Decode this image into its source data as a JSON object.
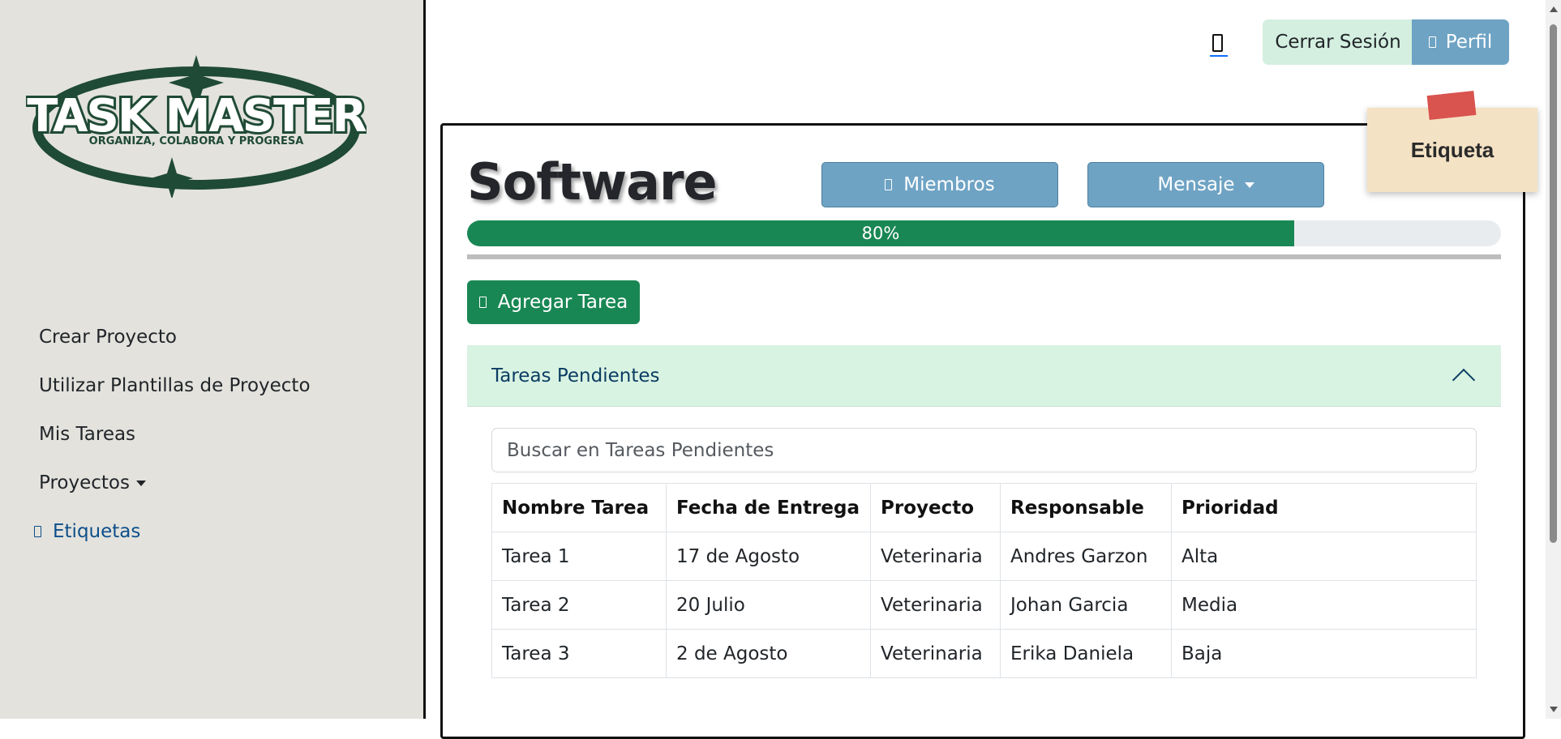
{
  "logo": {
    "title": "TASK MASTER",
    "tagline": "ORGANIZA, COLABORA Y PROGRESA"
  },
  "sidebar": {
    "items": [
      {
        "label": "Crear Proyecto"
      },
      {
        "label": "Utilizar Plantillas de Proyecto"
      },
      {
        "label": "Mis Tareas"
      },
      {
        "label": "Proyectos"
      },
      {
        "label": "Etiquetas",
        "icon": "label-icon",
        "active": true
      }
    ]
  },
  "header": {
    "phone_icon": "phone-icon",
    "logout_label": "Cerrar Sesión",
    "profile_label": "Perfil"
  },
  "project": {
    "title": "Software",
    "members_label": "Miembros",
    "message_label": "Mensaje",
    "progress_percent": 80,
    "progress_label": "80%",
    "add_task_label": "Agregar Tarea"
  },
  "sticky_note": {
    "label": "Etiqueta"
  },
  "pending": {
    "header": "Tareas Pendientes",
    "search_placeholder": "Buscar en Tareas Pendientes",
    "columns": [
      "Nombre Tarea",
      "Fecha de Entrega",
      "Proyecto",
      "Responsable",
      "Prioridad"
    ],
    "rows": [
      [
        "Tarea 1",
        "17 de Agosto",
        "Veterinaria",
        "Andres Garzon",
        "Alta"
      ],
      [
        "Tarea 2",
        "20 Julio",
        "Veterinaria",
        "Johan Garcia",
        "Media"
      ],
      [
        "Tarea 3",
        "2 de Agosto",
        "Veterinaria",
        "Erika Daniela",
        "Baja"
      ]
    ]
  },
  "colors": {
    "sidebar_bg": "#e3e2dd",
    "accent_blue": "#6ea3c4",
    "accent_green": "#198754",
    "logo_green": "#1f4a35"
  }
}
